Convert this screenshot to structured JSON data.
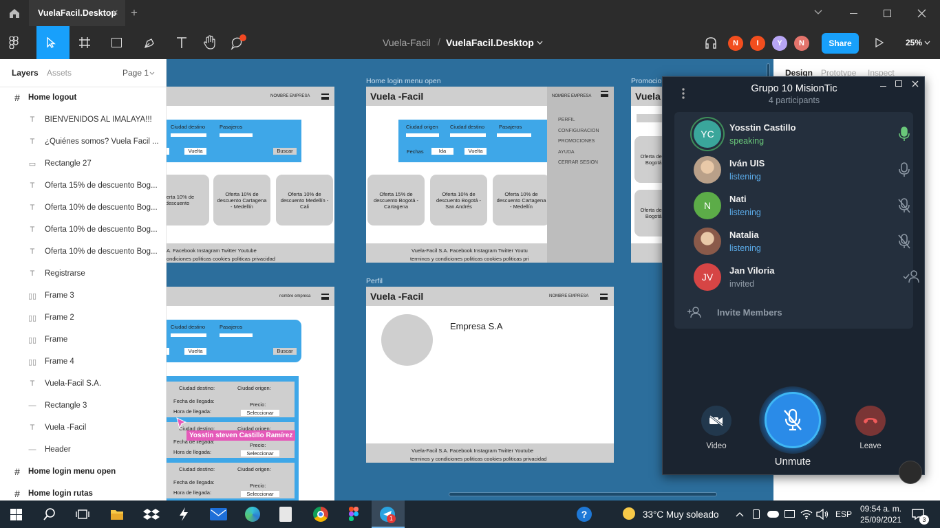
{
  "titlebar": {
    "home_icon": "home-icon",
    "tab_title": "VuelaFacil.Desktop",
    "close_tab": "×",
    "new_tab": "+"
  },
  "toolbar": {
    "breadcrumb_project": "Vuela-Facil",
    "separator": "/",
    "file_name": "VuelaFacil.Desktop",
    "share": "Share",
    "zoom": "25%",
    "avatars": [
      {
        "letter": "N",
        "color": "#f24e1e"
      },
      {
        "letter": "I",
        "color": "#f24e1e"
      },
      {
        "letter": "Y",
        "color": "#b8a6f5"
      },
      {
        "letter": "N",
        "color": "#e4746c"
      }
    ]
  },
  "layers_panel": {
    "tab_layers": "Layers",
    "tab_assets": "Assets",
    "page": "Page 1",
    "items": [
      {
        "label": "Home logout",
        "type": "frame",
        "top": true
      },
      {
        "label": "BIENVENIDOS AL IMALAYA!!!",
        "type": "text"
      },
      {
        "label": "¿Quiénes somos? Vuela Facil ...",
        "type": "text"
      },
      {
        "label": "Rectangle 27",
        "type": "rect"
      },
      {
        "label": "Oferta 15% de descuento Bog...",
        "type": "text"
      },
      {
        "label": "Oferta 10% de descuento Bog...",
        "type": "text"
      },
      {
        "label": "Oferta 10% de descuento Bog...",
        "type": "text"
      },
      {
        "label": "Oferta 10% de descuento Bog...",
        "type": "text"
      },
      {
        "label": "Registrarse",
        "type": "text"
      },
      {
        "label": "Frame 3",
        "type": "autolayout"
      },
      {
        "label": "Frame 2",
        "type": "autolayout"
      },
      {
        "label": "Frame",
        "type": "autolayout"
      },
      {
        "label": "Frame 4",
        "type": "autolayout"
      },
      {
        "label": "Vuela-Facil S.A.",
        "type": "text"
      },
      {
        "label": "Rectangle 3",
        "type": "line"
      },
      {
        "label": "Vuela -Facil",
        "type": "text"
      },
      {
        "label": "Header",
        "type": "line"
      },
      {
        "label": "Home login menu open",
        "type": "frame",
        "top": true
      },
      {
        "label": "Home login rutas",
        "type": "frame",
        "top": true
      }
    ]
  },
  "canvas": {
    "label_menu_open": "Home login menu open",
    "label_perfil": "Perfil",
    "label_promo": "Promocio",
    "brand": "Vuela -Facil",
    "brand_short": "Vuela",
    "nombre_empresa": "NOMBRE EMPRESA",
    "nombre_empresa_lower": "nombre empresa",
    "ciudad_origen": "Ciudad origen",
    "ciudad_destino": "Ciudad destino",
    "pasajeros": "Pasajeros",
    "fechas": "Fechas",
    "ida": "Ida",
    "vuelta": "Vuelta",
    "buscar": "Buscar",
    "menu": [
      "PERFIL",
      "CONFIGURACION",
      "PROMOCIONES",
      "AYUDA",
      "CERRAR SESION"
    ],
    "card_15": "Oferta 15% de descuento Bogotá - Cartagena",
    "card_10a": "Oferta 10% de descuento Bogotá - San Andrés",
    "card_10b": "Oferta 10% de descuento Cartagena - Medellín",
    "card_10c": "Oferta 10% de descuento Medellín - Cali",
    "card_partial1": "Oferta 10% de descuento",
    "card_partial1b": "á - San Andrés",
    "card_promo": "Oferta descu Bogotá -",
    "footer_line1": "Vuela-Facil S.A.   Facebook  Instagram  Twitter  Youtube",
    "footer_line2": "terminos y condiciones   politicas cookies   politicas privacidad",
    "footer_partial1": "A.   Facebook  Instagram  Twitter  Youtube",
    "footer_partial2": "ondiciones   politicas cookies   politicas privacidad",
    "footer_menu1": "Vuela-Facil S.A.   Facebook  Instagram  Twitter  Youtu",
    "footer_menu2": "terminos y condiciones   politicas cookies   politicas pri",
    "empresa": "Empresa S.A",
    "ruta": {
      "destino": "Ciudad destino:",
      "origen": "Ciudad origen:",
      "llegada": "Fecha de llegada:",
      "hora": "Hora de llegada:",
      "precio": "Precio:",
      "seleccionar": "Seleccionar"
    },
    "cursor_user": "Yosstin steven Castillo Ramírez"
  },
  "right_panel": {
    "design": "Design",
    "prototype": "Prototype",
    "inspect": "Inspect"
  },
  "telegram": {
    "title": "Grupo 10 MisionTic",
    "subtitle": "4 participants",
    "participants": [
      {
        "initials": "YC",
        "name": "Yosstin Castillo",
        "status": "speaking",
        "color": "#3aa69b",
        "mic": "mic-on-icon"
      },
      {
        "initials": "",
        "name": "Iván UIS",
        "status": "listening",
        "color": "#b9a089",
        "mic": "mic-icon"
      },
      {
        "initials": "N",
        "name": "Nati",
        "status": "listening",
        "color": "#5cac48",
        "mic": "mic-off-icon"
      },
      {
        "initials": "",
        "name": "Natalia",
        "status": "listening",
        "color": "#8a5a4a",
        "mic": "mic-off-icon"
      },
      {
        "initials": "JV",
        "name": "Jan Viloria",
        "status": "invited",
        "color": "#d64545",
        "mic": "invited-icon"
      }
    ],
    "invite": "Invite Members",
    "video": "Video",
    "unmute": "Unmute",
    "leave": "Leave"
  },
  "taskbar": {
    "weather": "33°C  Muy soleado",
    "lang": "ESP",
    "time": "09:54 a. m.",
    "date": "25/09/2021",
    "notifications": "3",
    "telegram_badge": "1"
  }
}
